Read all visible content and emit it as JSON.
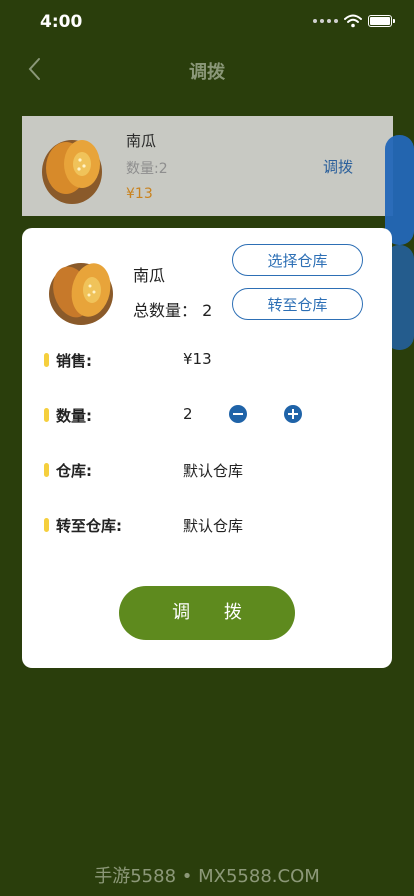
{
  "status_bar": {
    "time": "4:00"
  },
  "nav": {
    "title": "调拨"
  },
  "background_item": {
    "name": "南瓜",
    "quantity": "数量:2",
    "price": "¥13",
    "action": "调拨"
  },
  "modal": {
    "product_name": "南瓜",
    "total_quantity": "总数量： 2",
    "select_warehouse_button": "选择仓库",
    "transfer_to_warehouse_button": "转至仓库",
    "rows": [
      {
        "label": "销售:",
        "value": "¥13"
      },
      {
        "label": "数量:",
        "value": "2"
      },
      {
        "label": "仓库:",
        "value": "默认仓库"
      },
      {
        "label": "转至仓库:",
        "value": "默认仓库"
      }
    ],
    "submit_button": "调 拨"
  },
  "watermark": "手游5588 • MX5588.COM",
  "colors": {
    "background": "#2a3e0c",
    "accent_green": "#5e8a1e",
    "accent_blue": "#1f63a8",
    "marker_yellow": "#f5cf3d",
    "price_orange": "#c9821e"
  }
}
